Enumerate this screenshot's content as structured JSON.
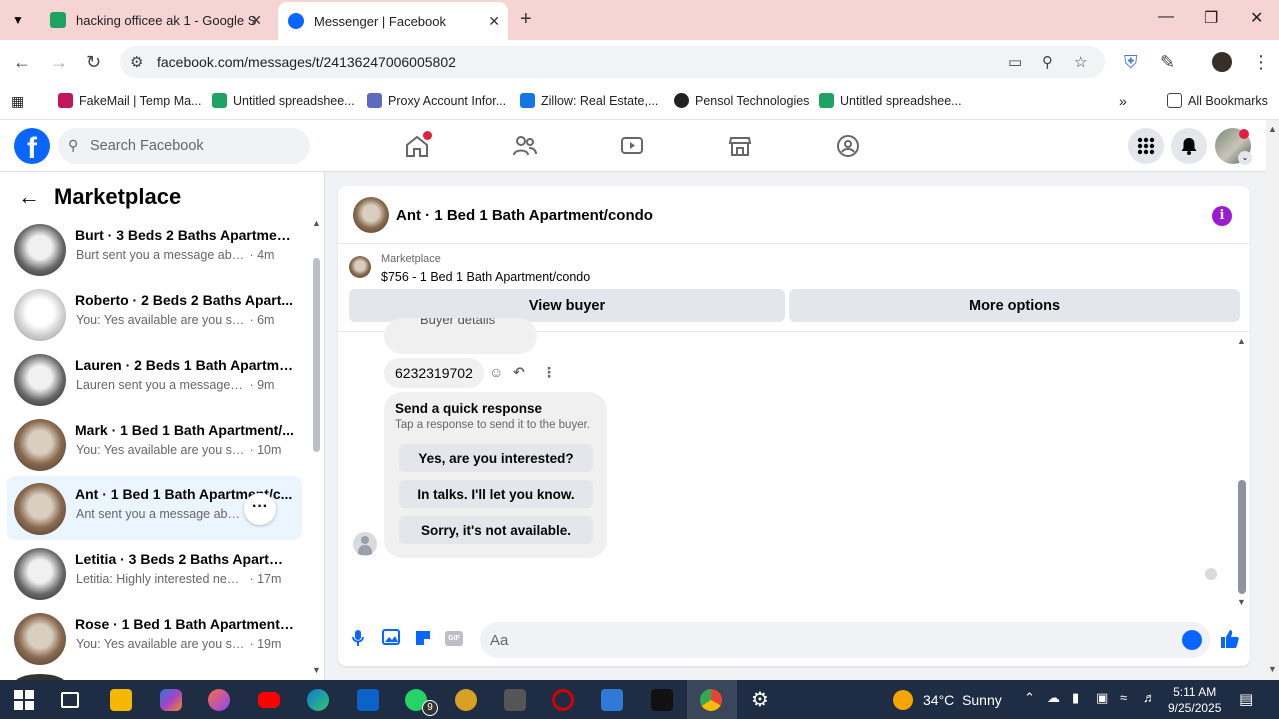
{
  "browser": {
    "tabs": [
      {
        "title": "hacking officee ak 1 - Google Sh",
        "icon": "sheets-icon",
        "active": false
      },
      {
        "title": "Messenger | Facebook",
        "icon": "facebook-icon",
        "active": true
      }
    ],
    "url": "facebook.com/messages/t/24136247006005802",
    "bookmarks": [
      {
        "label": "FakeMail | Temp Ma...",
        "icon": "fakemail-icon"
      },
      {
        "label": "Untitled spreadshee...",
        "icon": "sheets-icon"
      },
      {
        "label": "Proxy Account Infor...",
        "icon": "proxy-icon"
      },
      {
        "label": "Zillow: Real Estate,...",
        "icon": "zillow-icon"
      },
      {
        "label": "Pensol Technologies",
        "icon": "pensol-icon"
      },
      {
        "label": "Untitled spreadshee...",
        "icon": "sheets-icon"
      }
    ],
    "all_bookmarks": "All Bookmarks"
  },
  "facebook": {
    "search_placeholder": "Search Facebook",
    "logo_letter": "f"
  },
  "sidebar": {
    "title": "Marketplace",
    "conversations": [
      {
        "name": "Burt · 3 Beds 2 Baths Apartment...",
        "message": "Burt sent you a message about yo...",
        "time": "4m",
        "thumb": "dark"
      },
      {
        "name": "Roberto · 2 Beds 2 Baths Apart...",
        "message": "You: Yes available are you still inter...",
        "time": "6m",
        "thumb": "white"
      },
      {
        "name": "Lauren · 2 Beds 1 Bath Apartme...",
        "message": "Lauren sent you a message about ...",
        "time": "9m",
        "thumb": "dark"
      },
      {
        "name": "Mark · 1 Bed 1 Bath Apartment/...",
        "message": "You: Yes available are you still int...",
        "time": "10m",
        "thumb": "warm"
      },
      {
        "name": "Ant · 1 Bed 1 Bath Apartment/c...",
        "message": "Ant sent you a message about yo...",
        "time": "4m",
        "thumb": "warm",
        "active": true
      },
      {
        "name": "Letitia · 3 Beds 2 Baths Apartme...",
        "message": "Letitia: Highly interested need to ...",
        "time": "17m",
        "thumb": "dark"
      },
      {
        "name": "Rose · 1 Bed 1 Bath Apartment/c...",
        "message": "You: Yes available are you still int...",
        "time": "19m",
        "thumb": "warm"
      }
    ]
  },
  "chat": {
    "title": "Ant · 1 Bed 1 Bath Apartment/condo",
    "listing_source": "Marketplace",
    "listing_price": "$756 - 1 Bed 1 Bath Apartment/condo",
    "view_buyer": "View buyer",
    "more_options": "More options",
    "partial_bubble": "Buyer details",
    "phone_message": "6232319702",
    "quick_title": "Send a quick response",
    "quick_subtitle": "Tap a response to send it to the buyer.",
    "quick_replies": [
      "Yes, are you interested?",
      "In talks. I'll let you know.",
      "Sorry, it's not available."
    ],
    "composer_placeholder": "Aa",
    "gif_label": "GIF"
  },
  "taskbar": {
    "weather_temp": "34°C",
    "weather_desc": "Sunny",
    "time": "5:11 AM",
    "date": "9/25/2025",
    "whatsapp_badge": "9"
  },
  "colors": {
    "facebook_blue": "#0866ff",
    "tabbar_pink": "#f7d4d4",
    "active_conv": "#ebf5ff",
    "info_purple": "#9b1bd1"
  }
}
